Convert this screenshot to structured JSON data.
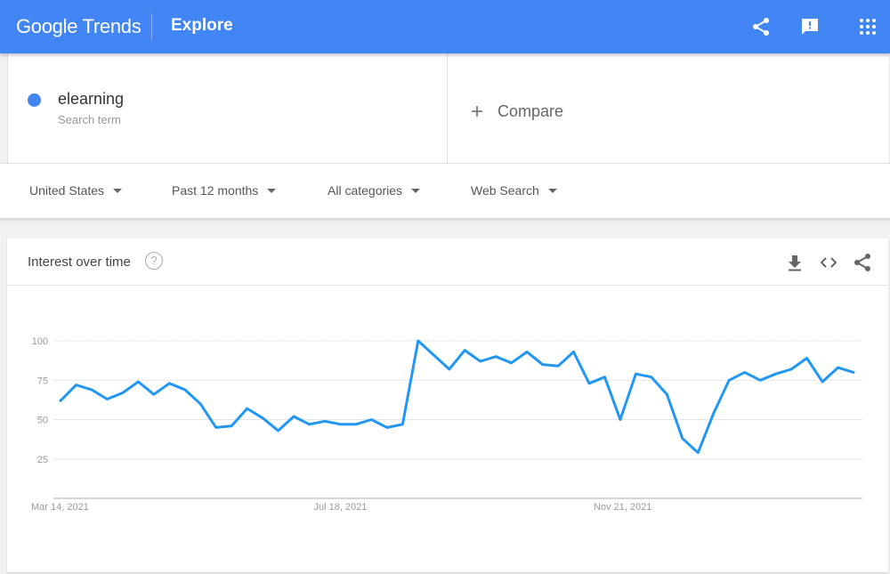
{
  "header": {
    "logo": "Google Trends",
    "section": "Explore",
    "icons": [
      "share-icon",
      "feedback-icon",
      "apps-grid-icon"
    ],
    "brand_color": "#4285f4"
  },
  "terms": {
    "term": "elearning",
    "term_type": "Search term",
    "term_color": "#4285f4",
    "compare_label": "Compare"
  },
  "filters": [
    {
      "label": "United States"
    },
    {
      "label": "Past 12 months"
    },
    {
      "label": "All categories"
    },
    {
      "label": "Web Search"
    }
  ],
  "card": {
    "title": "Interest over time",
    "help": "?",
    "icons": [
      "download-icon",
      "embed-icon",
      "share-icon"
    ]
  },
  "chart_data": {
    "type": "line",
    "title": "Interest over time",
    "xlabel": "",
    "ylabel": "",
    "ylim": [
      0,
      100
    ],
    "yticks": [
      25,
      50,
      75,
      100
    ],
    "xtick_labels": [
      {
        "index": 0,
        "label": "Mar 14, 2021"
      },
      {
        "index": 18,
        "label": "Jul 18, 2021"
      },
      {
        "index": 36,
        "label": "Nov 21, 2021"
      }
    ],
    "grid": true,
    "series": [
      {
        "name": "elearning",
        "color": "#2196f3",
        "values": [
          62,
          72,
          69,
          63,
          67,
          74,
          66,
          73,
          69,
          60,
          45,
          46,
          57,
          51,
          43,
          52,
          47,
          49,
          47,
          47,
          50,
          45,
          47,
          100,
          91,
          82,
          94,
          87,
          90,
          86,
          93,
          85,
          84,
          93,
          73,
          77,
          50,
          79,
          77,
          66,
          38,
          29,
          54,
          75,
          80,
          75,
          79,
          82,
          89,
          74,
          83,
          80
        ]
      }
    ]
  }
}
